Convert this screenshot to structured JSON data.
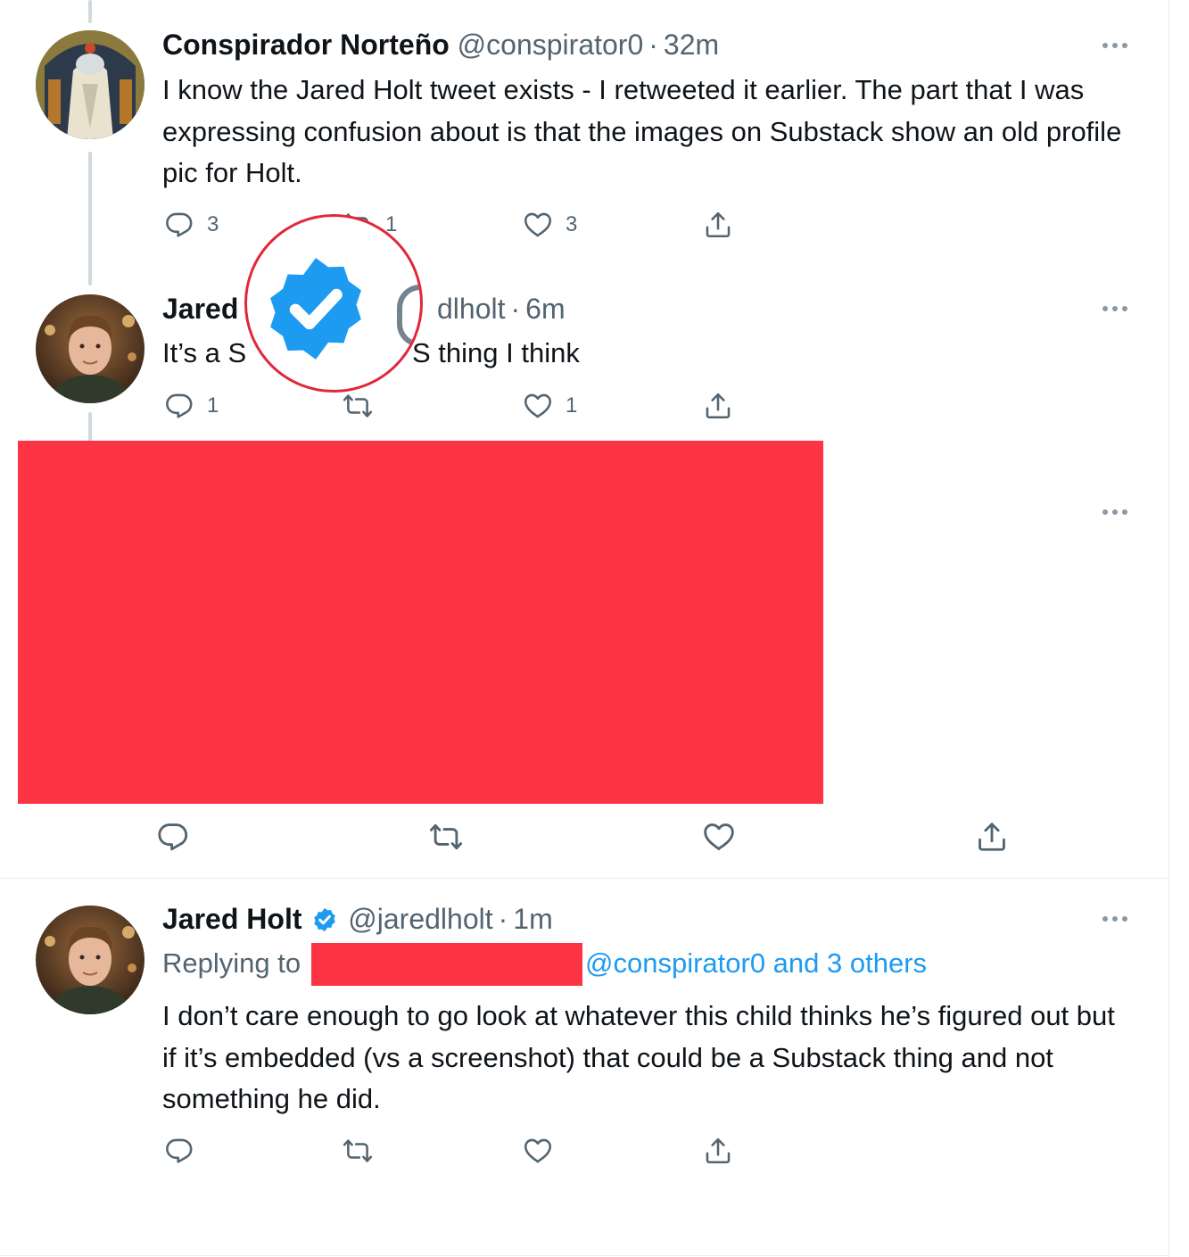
{
  "tweets": [
    {
      "name": "Conspirador Norteño",
      "handle": "@conspirator0",
      "dot": "·",
      "time": "32m",
      "text": "I know the Jared Holt tweet exists - I retweeted it earlier. The part that I was expressing confusion about is that the images on Substack show an old profile pic for Holt.",
      "replies": "3",
      "retweets": "1",
      "likes": "3"
    },
    {
      "name_partial": "Jared",
      "handle_partial": "dlholt",
      "dot": "·",
      "time": "6m",
      "text_start": "It’s a S",
      "text_end": "S thing I think",
      "replies": "1",
      "likes": "1"
    },
    {
      "name": "Jared Holt",
      "handle": "@jaredlholt",
      "dot": "·",
      "time": "1m",
      "replying_label": "Replying to",
      "replying_mentions": "@conspirator0 and 3 others",
      "text": "I don’t care enough to go look at whatever this child thinks he’s figured out but if it’s embedded (vs a screenshot) that could be a Substack thing and not something he did."
    }
  ],
  "icons": {
    "reply": "reply-icon",
    "retweet": "retweet-icon",
    "like": "heart-icon",
    "share": "share-icon",
    "more": "more-icon",
    "verified": "verified-badge-icon"
  },
  "colors": {
    "redaction": "#fd3443",
    "link": "#1d9bf0",
    "verified": "#1d9bf0",
    "zoom_circle": "#e0283a",
    "secondary_text": "#536471"
  }
}
